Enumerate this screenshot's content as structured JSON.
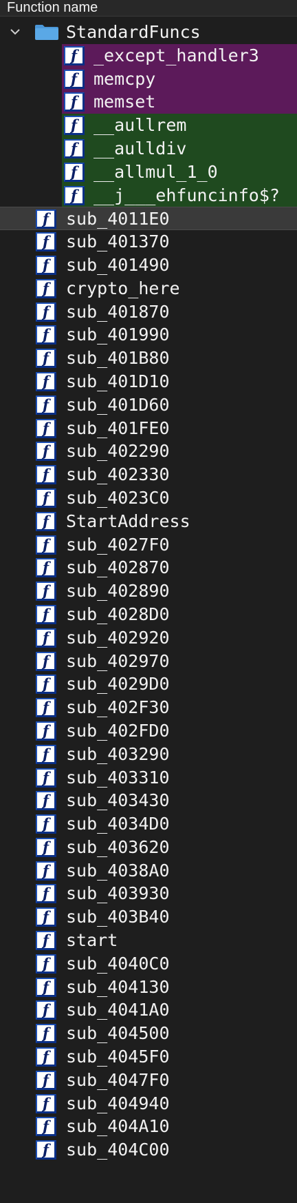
{
  "header": {
    "title": "Function name"
  },
  "colors": {
    "background": "#1e1e1e",
    "purple_highlight": "#5c1a5a",
    "green_highlight": "#1f4a1f",
    "selected_row": "#3a3a3a",
    "folder_blue": "#5aa8e6"
  },
  "folder": {
    "name": "StandardFuncs",
    "expanded": true,
    "children": [
      {
        "name": "_except_handler3",
        "highlight": "purple"
      },
      {
        "name": "memcpy",
        "highlight": "purple"
      },
      {
        "name": "memset",
        "highlight": "purple"
      },
      {
        "name": "__aullrem",
        "highlight": "green"
      },
      {
        "name": "__aulldiv",
        "highlight": "green"
      },
      {
        "name": "__allmul_1_0",
        "highlight": "green"
      },
      {
        "name": "__j___ehfuncinfo$?",
        "highlight": "green"
      }
    ]
  },
  "icons": {
    "function": "function-icon",
    "folder": "folder-icon",
    "chevron": "chevron-down-icon",
    "glyph": "f"
  },
  "selected_function": "sub_4011E0",
  "functions": [
    "sub_4011E0",
    "sub_401370",
    "sub_401490",
    "crypto_here",
    "sub_401870",
    "sub_401990",
    "sub_401B80",
    "sub_401D10",
    "sub_401D60",
    "sub_401FE0",
    "sub_402290",
    "sub_402330",
    "sub_4023C0",
    "StartAddress",
    "sub_4027F0",
    "sub_402870",
    "sub_402890",
    "sub_4028D0",
    "sub_402920",
    "sub_402970",
    "sub_4029D0",
    "sub_402F30",
    "sub_402FD0",
    "sub_403290",
    "sub_403310",
    "sub_403430",
    "sub_4034D0",
    "sub_403620",
    "sub_4038A0",
    "sub_403930",
    "sub_403B40",
    "start",
    "sub_4040C0",
    "sub_404130",
    "sub_4041A0",
    "sub_404500",
    "sub_4045F0",
    "sub_4047F0",
    "sub_404940",
    "sub_404A10",
    "sub_404C00"
  ]
}
